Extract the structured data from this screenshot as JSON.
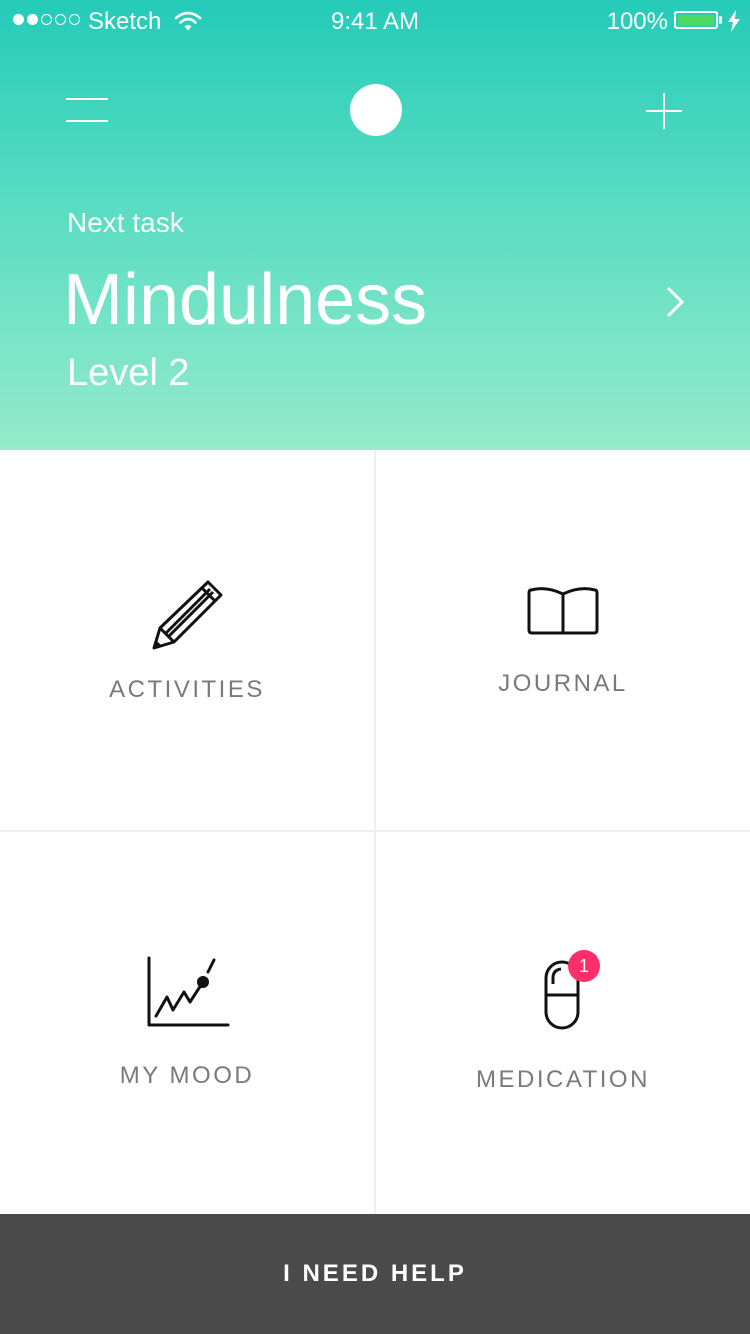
{
  "status_bar": {
    "carrier": "Sketch",
    "time": "9:41 AM",
    "battery": "100%",
    "signal_bars_filled": 2,
    "signal_bars_total": 5
  },
  "nav": {
    "menu_icon": "hamburger-icon",
    "avatar_icon": "avatar",
    "add_icon": "plus-icon"
  },
  "next_task": {
    "label": "Next task",
    "title": "Mindulness",
    "level": "Level 2"
  },
  "tiles": [
    {
      "label": "ACTIVITIES",
      "icon": "pencil-icon"
    },
    {
      "label": "JOURNAL",
      "icon": "book-icon"
    },
    {
      "label": "MY MOOD",
      "icon": "chart-icon"
    },
    {
      "label": "MEDICATION",
      "icon": "pill-icon",
      "badge": "1"
    }
  ],
  "help_button": "I NEED HELP",
  "colors": {
    "gradient_top": "#24cbb8",
    "gradient_bottom": "#95ebcb",
    "badge": "#ff2d6a",
    "help_bar": "#4a4a4a",
    "battery": "#4cd964"
  }
}
